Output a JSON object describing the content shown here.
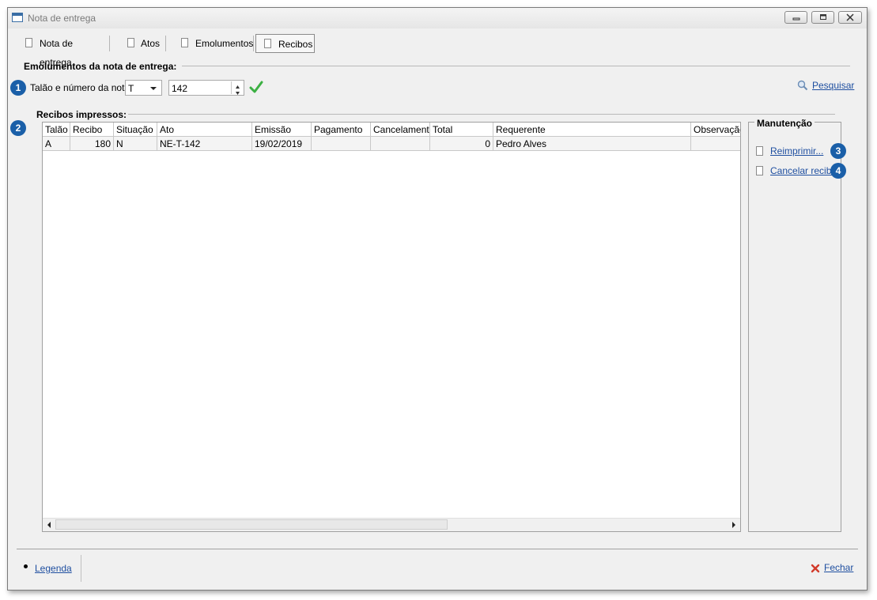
{
  "window": {
    "title": "Nota de entrega"
  },
  "tabs": [
    {
      "label": "Nota de entrega"
    },
    {
      "label": "Atos"
    },
    {
      "label": "Emolumentos"
    },
    {
      "label": "Recibos"
    }
  ],
  "section_emolumentos": {
    "title": "Emolumentos da nota de entrega:"
  },
  "nota_field": {
    "label": "Talão e número da nota:",
    "talao_value": "T",
    "numero_value": "142",
    "badge": "1"
  },
  "search": {
    "label": "Pesquisar"
  },
  "section_recibos": {
    "title": "Recibos impressos:",
    "badge": "2"
  },
  "table": {
    "columns": [
      "Talão",
      "Recibo",
      "Situação",
      "Ato",
      "Emissão",
      "Pagamento",
      "Cancelamento",
      "Total",
      "Requerente",
      "Observação"
    ],
    "rows": [
      {
        "talao": "A",
        "recibo": "180",
        "situacao": "N",
        "ato": "NE-T-142",
        "emissao": "19/02/2019",
        "pagamento": "",
        "cancelamento": "",
        "total": "0",
        "requerente": "Pedro Alves",
        "observacao": ""
      }
    ]
  },
  "manutencao": {
    "title": "Manutenção",
    "reimprimir": "Reimprimir...",
    "reimprimir_badge": "3",
    "cancelar": "Cancelar recibo",
    "cancelar_badge": "4"
  },
  "footer": {
    "legenda": "Legenda",
    "fechar": "Fechar"
  },
  "colors": {
    "badge": "#1a5fa8",
    "link": "#1f4fa0",
    "check": "#3cb043",
    "close_x": "#d23a2a"
  }
}
